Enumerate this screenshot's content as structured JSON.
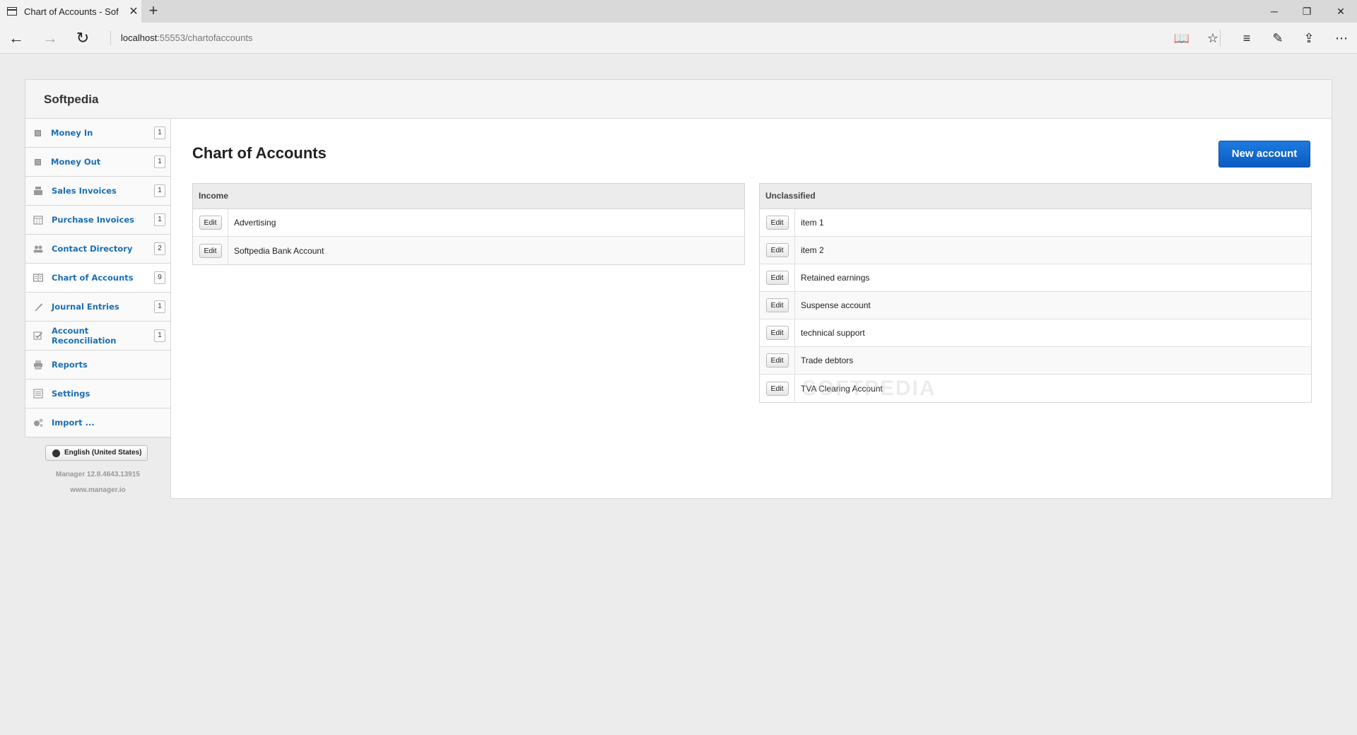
{
  "browser": {
    "tab_title": "Chart of Accounts - Sof",
    "url_host": "localhost",
    "url_rest": ":55553/chartofaccounts"
  },
  "app": {
    "brand": "Softpedia",
    "sidebar": {
      "items": [
        {
          "label": "Money In",
          "count": "1",
          "icon": "plus-box-icon"
        },
        {
          "label": "Money Out",
          "count": "1",
          "icon": "minus-box-icon"
        },
        {
          "label": "Sales Invoices",
          "count": "1",
          "icon": "cash-register-icon"
        },
        {
          "label": "Purchase Invoices",
          "count": "1",
          "icon": "calendar-icon"
        },
        {
          "label": "Contact Directory",
          "count": "2",
          "icon": "people-icon"
        },
        {
          "label": "Chart of Accounts",
          "count": "9",
          "icon": "ledger-icon"
        },
        {
          "label": "Journal Entries",
          "count": "1",
          "icon": "quill-icon"
        },
        {
          "label": "Account Reconciliation",
          "count": "1",
          "icon": "check-box-icon"
        },
        {
          "label": "Reports",
          "count": "",
          "icon": "printer-icon"
        },
        {
          "label": "Settings",
          "count": "",
          "icon": "settings-list-icon"
        },
        {
          "label": "Import ...",
          "count": "",
          "icon": "import-icon"
        }
      ]
    },
    "language": "English (United States)",
    "version": "Manager 12.8.4643.13915",
    "site": "www.manager.io"
  },
  "main": {
    "title": "Chart of Accounts",
    "new_button": "New account",
    "edit_label": "Edit",
    "income": {
      "heading": "Income",
      "accounts": [
        "Advertising",
        "Softpedia Bank Account"
      ]
    },
    "unclassified": {
      "heading": "Unclassified",
      "accounts": [
        "item 1",
        "item 2",
        "Retained earnings",
        "Suspense account",
        "technical support",
        "Trade debtors",
        "TVA Clearing Account"
      ]
    }
  },
  "watermark": "SOFTPEDIA"
}
